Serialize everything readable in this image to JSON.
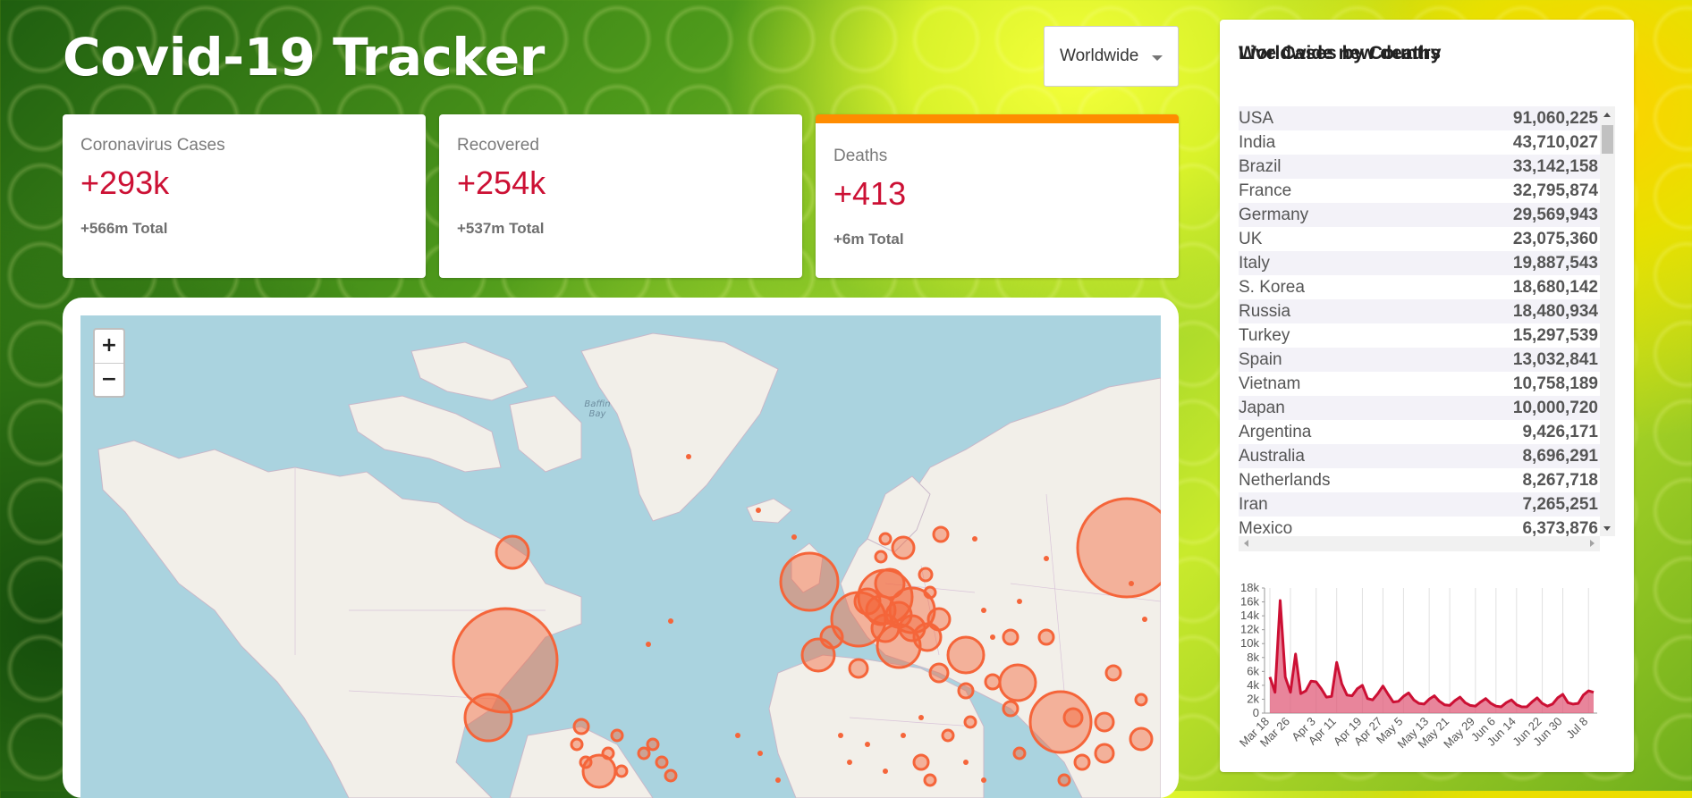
{
  "header": {
    "title": "Covid-19 Tracker"
  },
  "country_select": {
    "selected": "Worldwide"
  },
  "cards": [
    {
      "label": "Coronavirus Cases",
      "value": "+293k",
      "total": "+566m Total"
    },
    {
      "label": "Recovered",
      "value": "+254k",
      "total": "+537m Total"
    },
    {
      "label": "Deaths",
      "value": "+413",
      "total": "+6m Total"
    }
  ],
  "map": {
    "zoom_in": "+",
    "zoom_out": "−",
    "label_baffin_bay": "Baffin Bay"
  },
  "table": {
    "title": "Live Cases by Country",
    "rows": [
      {
        "country": "USA",
        "cases": "91,060,225"
      },
      {
        "country": "India",
        "cases": "43,710,027"
      },
      {
        "country": "Brazil",
        "cases": "33,142,158"
      },
      {
        "country": "France",
        "cases": "32,795,874"
      },
      {
        "country": "Germany",
        "cases": "29,569,943"
      },
      {
        "country": "UK",
        "cases": "23,075,360"
      },
      {
        "country": "Italy",
        "cases": "19,887,543"
      },
      {
        "country": "S. Korea",
        "cases": "18,680,142"
      },
      {
        "country": "Russia",
        "cases": "18,480,934"
      },
      {
        "country": "Turkey",
        "cases": "15,297,539"
      },
      {
        "country": "Spain",
        "cases": "13,032,841"
      },
      {
        "country": "Vietnam",
        "cases": "10,758,189"
      },
      {
        "country": "Japan",
        "cases": "10,000,720"
      },
      {
        "country": "Argentina",
        "cases": "9,426,171"
      },
      {
        "country": "Australia",
        "cases": "8,696,291"
      },
      {
        "country": "Netherlands",
        "cases": "8,267,718"
      },
      {
        "country": "Iran",
        "cases": "7,265,251"
      },
      {
        "country": "Mexico",
        "cases": "6,373,876"
      }
    ]
  },
  "chart_data": {
    "type": "area",
    "title": "Worldwide new deaths",
    "yticks": [
      "0",
      "2k",
      "4k",
      "6k",
      "8k",
      "10k",
      "12k",
      "14k",
      "16k",
      "18k"
    ],
    "ylim": [
      0,
      18000
    ],
    "xticks": [
      "Mar 18",
      "Mar 26",
      "Apr 3",
      "Apr 11",
      "Apr 19",
      "Apr 27",
      "May 5",
      "May 13",
      "May 21",
      "May 29",
      "Jun 6",
      "Jun 14",
      "Jun 22",
      "Jun 30",
      "Jul 8"
    ],
    "values": [
      5200,
      3000,
      16200,
      5200,
      3000,
      8500,
      2800,
      3200,
      4600,
      4500,
      3500,
      2300,
      2400,
      7300,
      4200,
      2600,
      2500,
      3500,
      4000,
      2100,
      1900,
      2800,
      3900,
      2700,
      1600,
      1700,
      2400,
      2900,
      1900,
      1400,
      1300,
      2000,
      2500,
      1700,
      1200,
      1100,
      1800,
      2300,
      1500,
      1100,
      1000,
      1600,
      2100,
      1400,
      1000,
      900,
      1500,
      1900,
      1200,
      900,
      900,
      1600,
      2200,
      1400,
      1000,
      1300,
      2200,
      2700,
      1500,
      1300,
      1400,
      2600,
      3200,
      3000
    ],
    "colors": {
      "line": "#cc1034",
      "fill": "#e05c7a"
    }
  },
  "colors": {
    "accent_red": "#cc1034",
    "active_card_border": "#ff8c00",
    "map_circle": "#f5653a"
  }
}
